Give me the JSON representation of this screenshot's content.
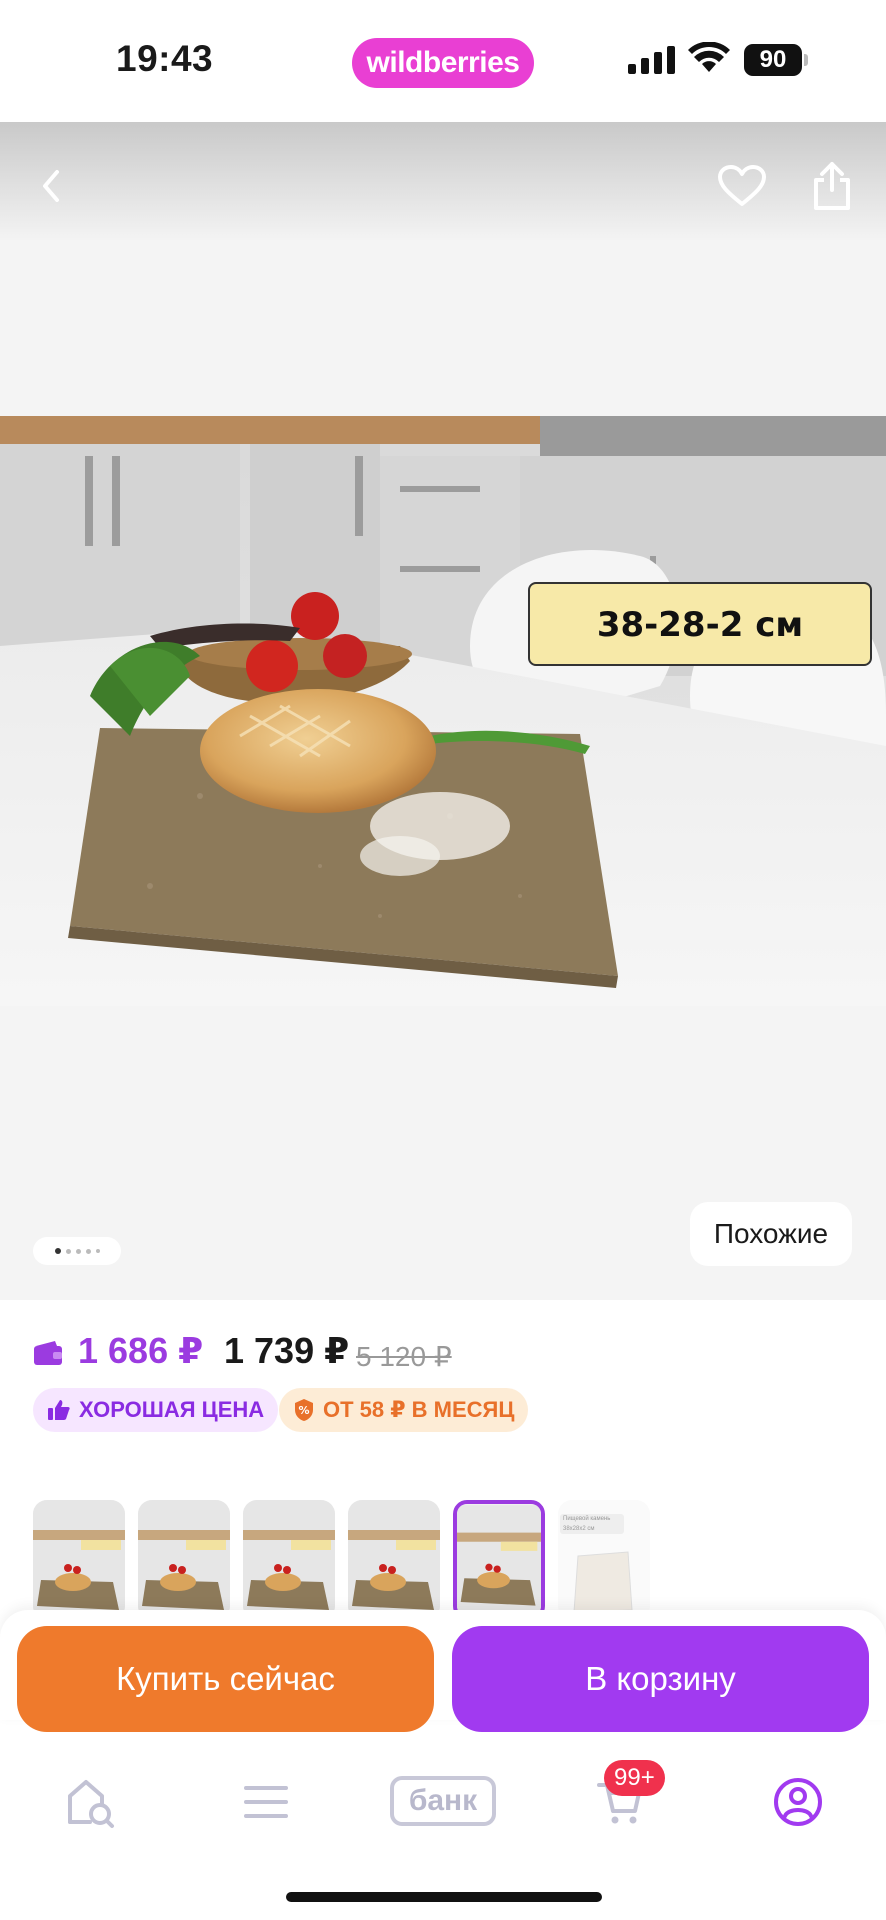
{
  "status_bar": {
    "time": "19:43",
    "brand": "wildberries",
    "battery": "90"
  },
  "gallery": {
    "size_label": "38-28-2 см",
    "similar_label": "Похожие",
    "page_count": 5,
    "active_page": 1
  },
  "price": {
    "wallet_price": "1 686 ₽",
    "price": "1 739 ₽",
    "old_price": "5 120 ₽",
    "badge_good": "ХОРОШАЯ ЦЕНА",
    "badge_month": "ОТ 58 ₽ В МЕСЯЦ"
  },
  "thumbnails": {
    "count": 6,
    "selected_index": 5,
    "last_caption": "Пищевой камень 38х28х2 см"
  },
  "actions": {
    "buy_now": "Купить сейчас",
    "add_to_cart": "В корзину"
  },
  "tabbar": {
    "bank_label": "банк",
    "cart_badge": "99+"
  },
  "colors": {
    "brand": "#e93fd3",
    "accent_purple": "#a13af0",
    "accent_orange": "#ef7a2c",
    "badge_red": "#f0314d"
  }
}
